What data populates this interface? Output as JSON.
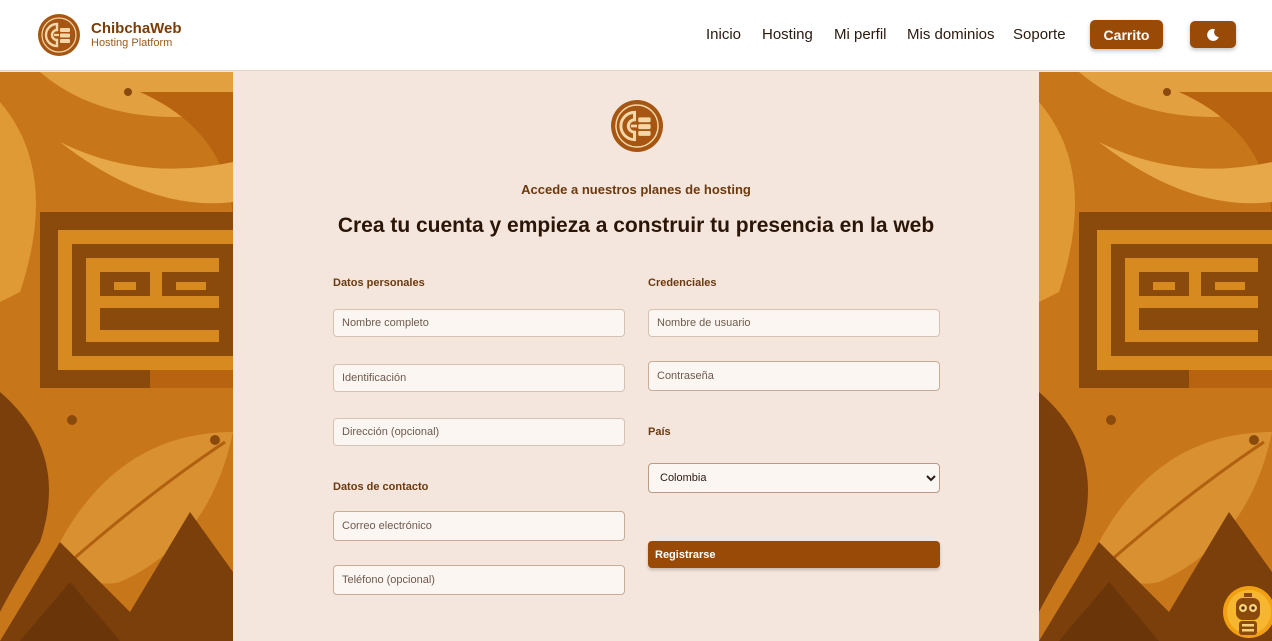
{
  "header": {
    "brand_name": "ChibchaWeb",
    "brand_sub": "Hosting Platform",
    "nav": [
      "Inicio",
      "Hosting",
      "Mi perfil",
      "Mis dominios",
      "Soporte"
    ],
    "cart_label": "Carrito",
    "theme_icon": "moon-icon"
  },
  "form": {
    "subtitle": "Accede a nuestros planes de hosting",
    "title": "Crea tu cuenta y empieza a construir tu presencia en la web",
    "personal_label": "Datos personales",
    "credentials_label": "Credenciales",
    "contact_label": "Datos de contacto",
    "country_label": "País",
    "placeholders": {
      "full_name": "Nombre completo",
      "id": "Identificación",
      "address": "Dirección (opcional)",
      "email": "Correo electrónico",
      "phone": "Teléfono (opcional)",
      "username": "Nombre de usuario",
      "password": "Contraseña"
    },
    "country_value": "Colombia",
    "submit_label": "Registrarse"
  },
  "colors": {
    "brand": "#9a4a07",
    "panel_bg": "#f4e6dc",
    "pattern_light": "#d68a1f",
    "pattern_dark": "#8a4a0c"
  }
}
